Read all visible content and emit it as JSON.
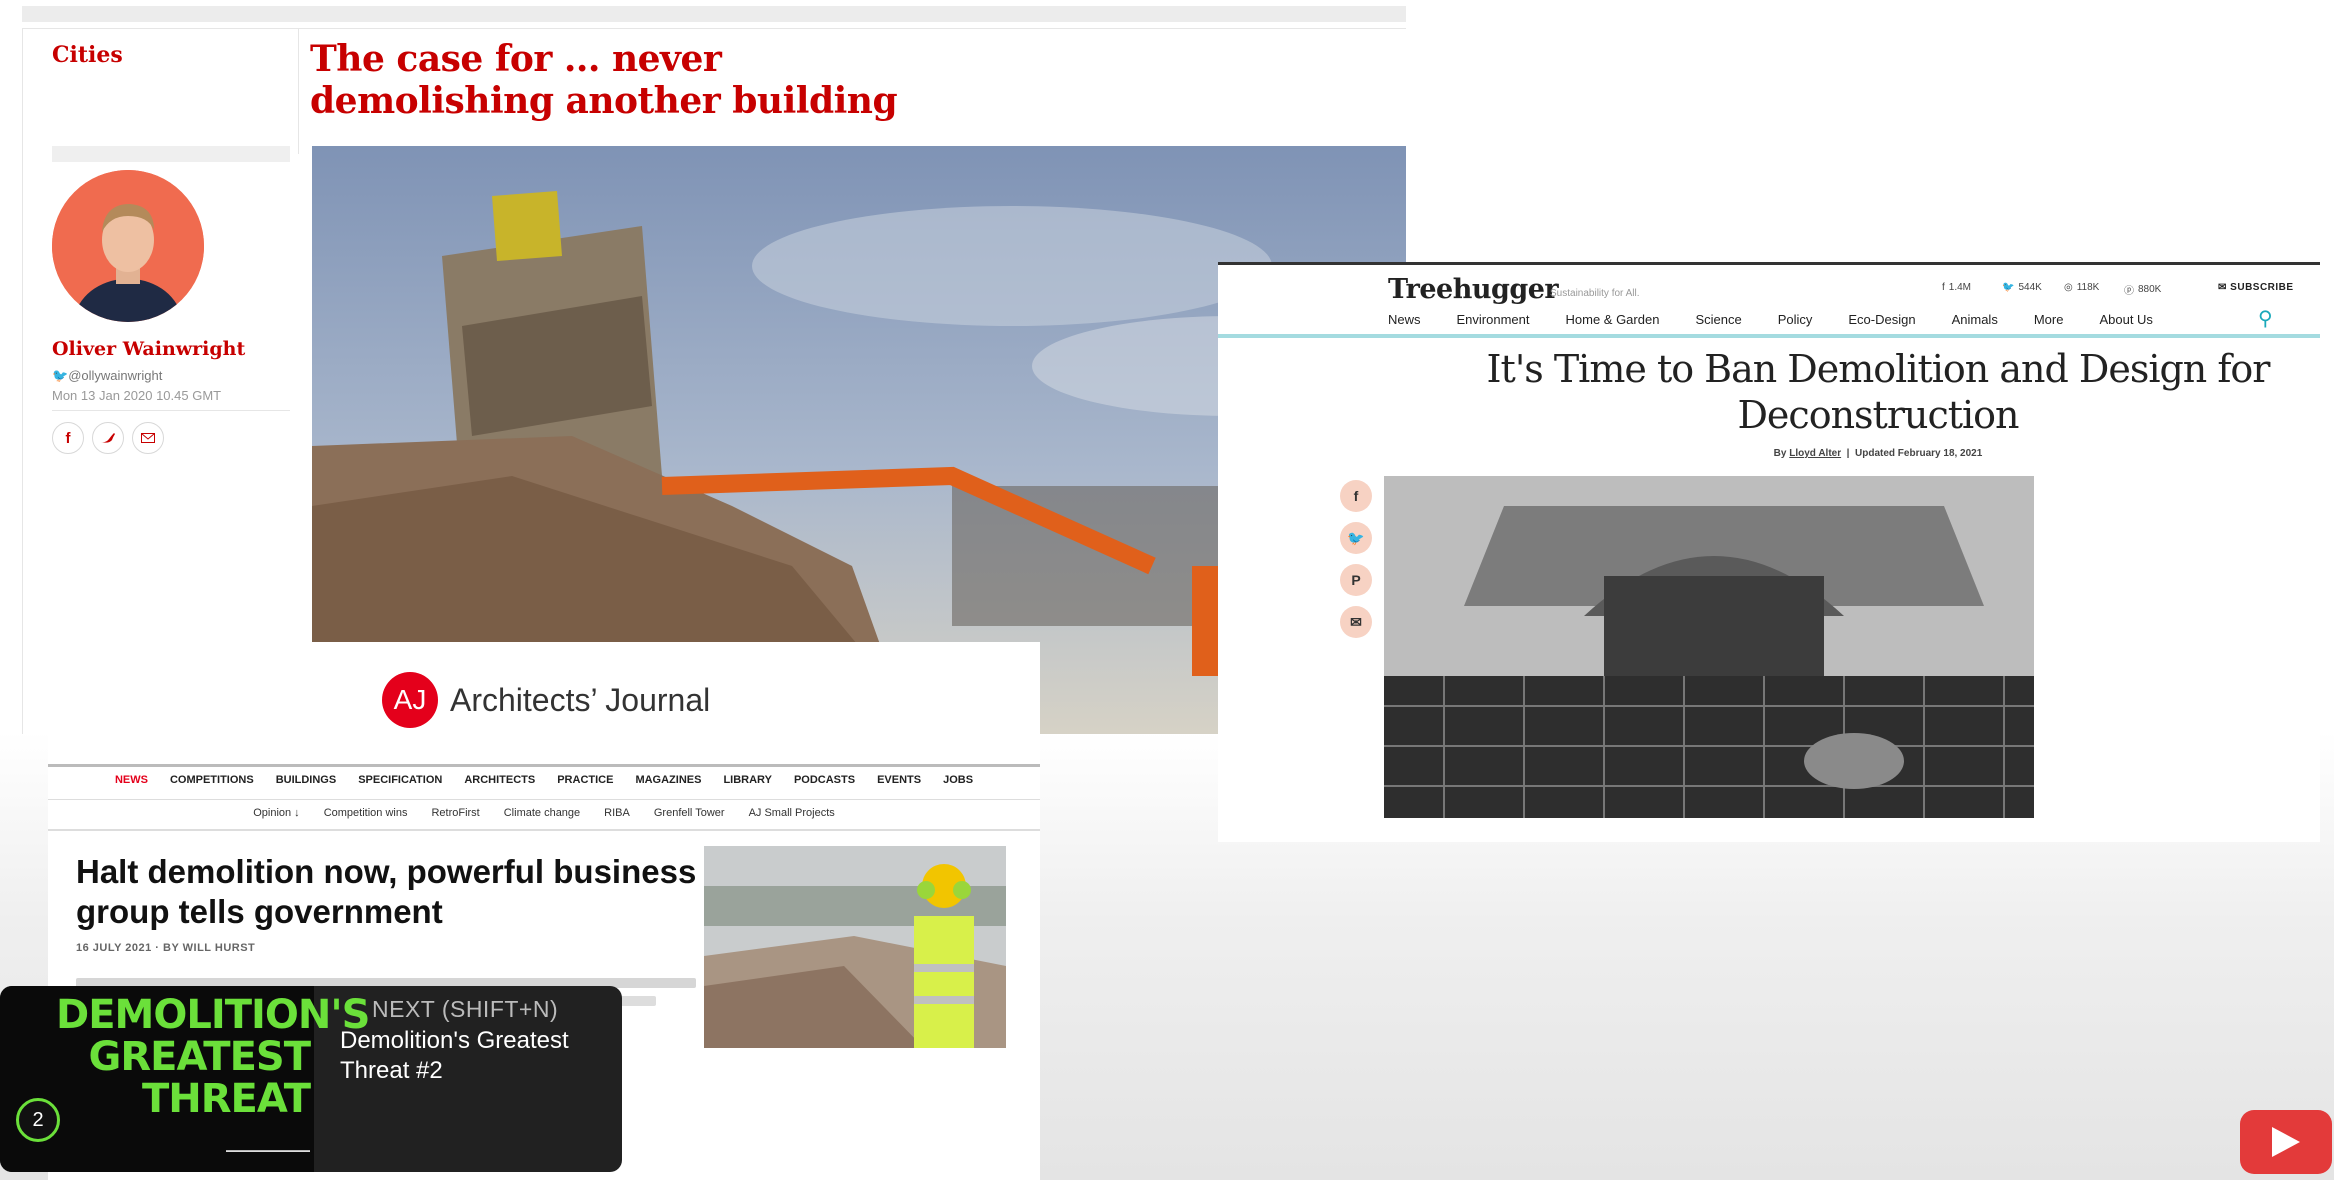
{
  "guardian": {
    "section": "Cities",
    "headline": "The case for ... never demolishing another building",
    "author": "Oliver Wainwright",
    "handle": "@ollywainwright",
    "date": "Mon 13 Jan 2020 10.45 GMT",
    "share_icons": [
      "facebook-icon",
      "twitter-icon",
      "email-icon"
    ]
  },
  "aj": {
    "logo_text": "AJ",
    "name": "Architects’ Journal",
    "nav": [
      "NEWS",
      "COMPETITIONS",
      "BUILDINGS",
      "SPECIFICATION",
      "ARCHITECTS",
      "PRACTICE",
      "MAGAZINES",
      "LIBRARY",
      "PODCASTS",
      "EVENTS",
      "JOBS"
    ],
    "subnav": [
      "Opinion ↓",
      "Competition wins",
      "RetroFirst",
      "Climate change",
      "RIBA",
      "Grenfell Tower",
      "AJ Small Projects"
    ],
    "headline": "Halt demolition now, powerful business group tells government",
    "byline": "16 JULY 2021 · BY WILL HURST",
    "accent": "#e4001b"
  },
  "treehugger": {
    "logo": "Treehugger",
    "tagline": "Sustainability for All.",
    "social": {
      "facebook": "1.4M",
      "twitter": "544K",
      "instagram": "118K",
      "pinterest": "880K"
    },
    "subscribe": "SUBSCRIBE",
    "nav": [
      "News",
      "Environment",
      "Home & Garden",
      "Science",
      "Policy",
      "Eco-Design",
      "Animals",
      "More",
      "About Us"
    ],
    "headline": "It's Time to Ban Demolition and Design for Deconstruction",
    "by": "By",
    "author": "Lloyd Alter",
    "updated": "Updated February 18, 2021",
    "share_icons": [
      "facebook-icon",
      "twitter-icon",
      "pinterest-icon",
      "email-icon"
    ]
  },
  "up_next": {
    "thumb_title_1": "DEMOLITION'S",
    "thumb_title_2": "GREATEST",
    "thumb_title_3": "THREAT",
    "episode_number": "2",
    "next_label": "NEXT (SHIFT+N)",
    "video_title": "Demolition's Greatest Threat #2"
  }
}
